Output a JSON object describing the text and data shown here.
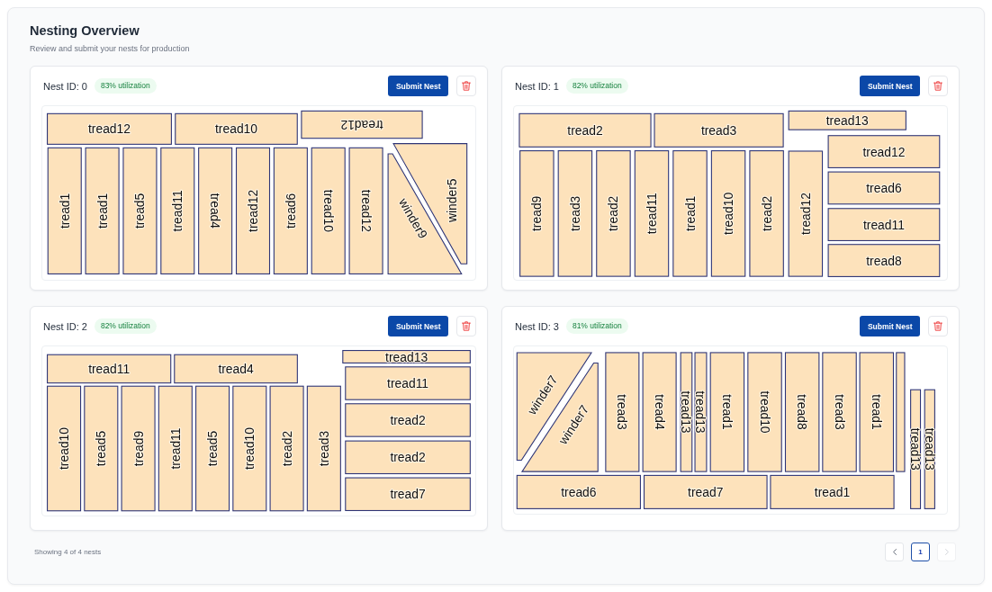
{
  "header": {
    "title": "Nesting Overview",
    "subtitle": "Review and submit your nests for production"
  },
  "nests": [
    {
      "id_label": "Nest ID: 0",
      "utilization": "83% utilization",
      "submit_label": "Submit Nest",
      "pieces": [
        {
          "kind": "tread",
          "label": "tread12",
          "flipped": false
        },
        {
          "kind": "tread",
          "label": "tread10",
          "flipped": false
        },
        {
          "kind": "tread",
          "label": "tread12",
          "flipped": true
        },
        {
          "kind": "tread",
          "label": "tread1",
          "flipped": false
        },
        {
          "kind": "tread",
          "label": "tread1",
          "flipped": false
        },
        {
          "kind": "tread",
          "label": "tread5",
          "flipped": false
        },
        {
          "kind": "tread",
          "label": "tread11",
          "flipped": false
        },
        {
          "kind": "tread",
          "label": "tread4",
          "flipped": true
        },
        {
          "kind": "tread",
          "label": "tread12",
          "flipped": false
        },
        {
          "kind": "tread",
          "label": "tread6",
          "flipped": false
        },
        {
          "kind": "tread",
          "label": "tread10",
          "flipped": true
        },
        {
          "kind": "tread",
          "label": "tread12",
          "flipped": true
        },
        {
          "kind": "winder",
          "label": "winder9",
          "flipped": false
        },
        {
          "kind": "winder",
          "label": "winder5",
          "flipped": false
        }
      ]
    },
    {
      "id_label": "Nest ID: 1",
      "utilization": "82% utilization",
      "submit_label": "Submit Nest",
      "pieces": [
        {
          "kind": "tread",
          "label": "tread2",
          "flipped": false
        },
        {
          "kind": "tread",
          "label": "tread3",
          "flipped": false
        },
        {
          "kind": "tread",
          "label": "tread13",
          "flipped": false
        },
        {
          "kind": "tread",
          "label": "tread9",
          "flipped": false
        },
        {
          "kind": "tread",
          "label": "tread3",
          "flipped": false
        },
        {
          "kind": "tread",
          "label": "tread2",
          "flipped": false
        },
        {
          "kind": "tread",
          "label": "tread11",
          "flipped": false
        },
        {
          "kind": "tread",
          "label": "tread1",
          "flipped": false
        },
        {
          "kind": "tread",
          "label": "tread10",
          "flipped": false
        },
        {
          "kind": "tread",
          "label": "tread2",
          "flipped": false
        },
        {
          "kind": "tread",
          "label": "tread12",
          "flipped": false
        },
        {
          "kind": "tread",
          "label": "tread12",
          "flipped": false
        },
        {
          "kind": "tread",
          "label": "tread6",
          "flipped": false
        },
        {
          "kind": "tread",
          "label": "tread11",
          "flipped": false
        },
        {
          "kind": "tread",
          "label": "tread8",
          "flipped": false
        }
      ]
    },
    {
      "id_label": "Nest ID: 2",
      "utilization": "82% utilization",
      "submit_label": "Submit Nest",
      "pieces": [
        {
          "kind": "tread",
          "label": "tread11",
          "flipped": false
        },
        {
          "kind": "tread",
          "label": "tread4",
          "flipped": false
        },
        {
          "kind": "tread",
          "label": "tread13",
          "flipped": false
        },
        {
          "kind": "tread",
          "label": "tread10",
          "flipped": false
        },
        {
          "kind": "tread",
          "label": "tread5",
          "flipped": false
        },
        {
          "kind": "tread",
          "label": "tread9",
          "flipped": false
        },
        {
          "kind": "tread",
          "label": "tread11",
          "flipped": false
        },
        {
          "kind": "tread",
          "label": "tread5",
          "flipped": false
        },
        {
          "kind": "tread",
          "label": "tread10",
          "flipped": false
        },
        {
          "kind": "tread",
          "label": "tread2",
          "flipped": false
        },
        {
          "kind": "tread",
          "label": "tread3",
          "flipped": false
        },
        {
          "kind": "tread",
          "label": "tread11",
          "flipped": false
        },
        {
          "kind": "tread",
          "label": "tread2",
          "flipped": false
        },
        {
          "kind": "tread",
          "label": "tread2",
          "flipped": false
        },
        {
          "kind": "tread",
          "label": "tread7",
          "flipped": false
        }
      ]
    },
    {
      "id_label": "Nest ID: 3",
      "utilization": "81% utilization",
      "submit_label": "Submit Nest",
      "pieces": [
        {
          "kind": "winder",
          "label": "winder7",
          "flipped": false
        },
        {
          "kind": "winder",
          "label": "winder7",
          "flipped": false
        },
        {
          "kind": "tread",
          "label": "tread3",
          "flipped": true
        },
        {
          "kind": "tread",
          "label": "tread4",
          "flipped": true
        },
        {
          "kind": "tread",
          "label": "tread13",
          "flipped": true
        },
        {
          "kind": "tread",
          "label": "tread13",
          "flipped": true
        },
        {
          "kind": "tread",
          "label": "tread1",
          "flipped": true
        },
        {
          "kind": "tread",
          "label": "tread10",
          "flipped": true
        },
        {
          "kind": "tread",
          "label": "tread8",
          "flipped": true
        },
        {
          "kind": "tread",
          "label": "tread3",
          "flipped": true
        },
        {
          "kind": "tread",
          "label": "tread1",
          "flipped": true
        },
        {
          "kind": "tread"
        },
        {
          "kind": "tread",
          "label": "tread13",
          "flipped": true
        },
        {
          "kind": "tread",
          "label": "tread13",
          "flipped": true
        },
        {
          "kind": "tread",
          "label": "tread6",
          "flipped": false
        },
        {
          "kind": "tread",
          "label": "tread7",
          "flipped": false
        },
        {
          "kind": "tread",
          "label": "tread1",
          "flipped": false
        }
      ]
    }
  ],
  "footer": {
    "summary": "Showing 4 of 4 nests",
    "pagination": {
      "previous": {
        "disabled": false
      },
      "pages": [
        {
          "label": "1",
          "selected": true
        }
      ],
      "next": {
        "disabled": true
      }
    }
  }
}
